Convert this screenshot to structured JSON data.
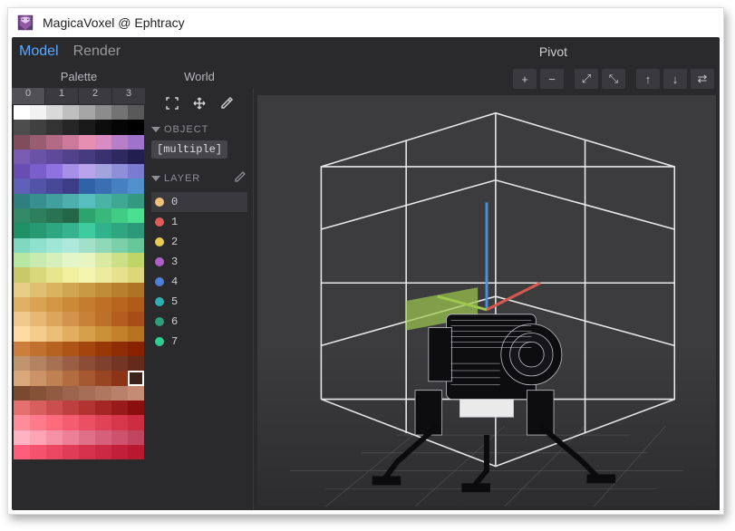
{
  "window": {
    "title": "MagicaVoxel @ Ephtracy"
  },
  "modes": {
    "model": "Model",
    "render": "Render",
    "active": "model",
    "pivot_label": "Pivot"
  },
  "palette": {
    "heading": "Palette",
    "tabs": [
      "0",
      "1",
      "2",
      "3"
    ],
    "active_tab": 0,
    "selected_index": 151,
    "colors": [
      "#ffffff",
      "#f2f2f2",
      "#d9d9d9",
      "#bfbfbf",
      "#a6a6a6",
      "#8c8c8c",
      "#737373",
      "#595959",
      "#4d4d4d",
      "#404040",
      "#333333",
      "#262626",
      "#1a1a1a",
      "#0d0d0d",
      "#050505",
      "#000000",
      "#804d5c",
      "#995c70",
      "#b36b85",
      "#cc7a99",
      "#e68fb0",
      "#d98cc2",
      "#b87fc9",
      "#9f73cc",
      "#7a5cb3",
      "#6a52a6",
      "#5e4a99",
      "#52428c",
      "#463a80",
      "#3a3270",
      "#2e2960",
      "#221f50",
      "#6a4db3",
      "#7a5ecc",
      "#8f72e0",
      "#a68fe6",
      "#b8a3eb",
      "#a3a3e0",
      "#8f8fd9",
      "#7a7ad0",
      "#5f5fb8",
      "#5353a8",
      "#484898",
      "#3d3d87",
      "#2f62a6",
      "#3a70b3",
      "#4580c0",
      "#5090cd",
      "#2e8080",
      "#388f8f",
      "#429f9f",
      "#4daeae",
      "#57bdbd",
      "#4ab3a3",
      "#3ea893",
      "#339980",
      "#338a66",
      "#2e805c",
      "#297352",
      "#246648",
      "#2fa36e",
      "#38b87a",
      "#40cc85",
      "#4adf91",
      "#1f8f66",
      "#269973",
      "#2ea680",
      "#36b38c",
      "#3ecc9e",
      "#30b38c",
      "#2ea680",
      "#2c997a",
      "#80d8c0",
      "#8fe0cc",
      "#9fe6d7",
      "#aee8db",
      "#a3e0c9",
      "#8fd9b8",
      "#7ad0a8",
      "#66c799",
      "#b8e6a3",
      "#c7ebb0",
      "#d6f0bd",
      "#e4f5ca",
      "#e6f5c2",
      "#d9eba3",
      "#cce085",
      "#bfd666",
      "#c9c96a",
      "#d9d97a",
      "#e6e68c",
      "#f0f09e",
      "#f5f5b0",
      "#edeb9e",
      "#e5e18c",
      "#ddd67a",
      "#e6cc85",
      "#e0bf73",
      "#d9b360",
      "#d1a652",
      "#c99945",
      "#c08c38",
      "#b8802e",
      "#b07326",
      "#e0b066",
      "#d9a352",
      "#d29645",
      "#cc8938",
      "#c57c2e",
      "#bf7026",
      "#b8661f",
      "#b05c18",
      "#f0c98c",
      "#e6b873",
      "#dba65c",
      "#d1944a",
      "#c78238",
      "#bd702a",
      "#b35e1f",
      "#a84d16",
      "#ffdba3",
      "#f5cc8c",
      "#ebbd75",
      "#e0ae5e",
      "#d69f4a",
      "#cc9038",
      "#c2812a",
      "#b87320",
      "#cc7f3d",
      "#c2702e",
      "#b86221",
      "#ae5416",
      "#a3450d",
      "#993807",
      "#902c03",
      "#872100",
      "#bf946e",
      "#b38260",
      "#a67052",
      "#995e45",
      "#8c4c38",
      "#80402e",
      "#733524",
      "#662a1a",
      "#d9a87a",
      "#cc9466",
      "#bf8052",
      "#b36c40",
      "#a65830",
      "#994524",
      "#8c3318",
      "#3b2319",
      "#7a4a2e",
      "#855238",
      "#915b42",
      "#9c644c",
      "#a66d56",
      "#b07760",
      "#ba816a",
      "#c58b74",
      "#e66f6f",
      "#d95e5e",
      "#cc4f4f",
      "#bf4040",
      "#b33333",
      "#a62626",
      "#991a1a",
      "#8c0f0f",
      "#ff8c99",
      "#ff7a8a",
      "#ff6b7d",
      "#f55c70",
      "#eb4f63",
      "#e04256",
      "#d6384a",
      "#cc2e40",
      "#ffb3c2",
      "#ffa3b5",
      "#f591a5",
      "#eb8096",
      "#e07088",
      "#d6607a",
      "#cc526d",
      "#c24560",
      "#ff5e7a",
      "#f5526e",
      "#eb4763",
      "#e03c58",
      "#d6324e",
      "#cc2944",
      "#c2203a",
      "#b81830"
    ]
  },
  "world": {
    "heading": "World",
    "object_label": "OBJECT",
    "object_value": "[multiple]",
    "layer_label": "LAYER",
    "layers": [
      {
        "num": "0",
        "color": "#f2c27a",
        "active": true
      },
      {
        "num": "1",
        "color": "#e05c5c",
        "active": false
      },
      {
        "num": "2",
        "color": "#e6cc52",
        "active": false
      },
      {
        "num": "3",
        "color": "#b060c9",
        "active": false
      },
      {
        "num": "4",
        "color": "#4f7fd6",
        "active": false
      },
      {
        "num": "5",
        "color": "#2fb0b0",
        "active": false
      },
      {
        "num": "6",
        "color": "#2f9e7a",
        "active": false
      },
      {
        "num": "7",
        "color": "#2ecc91",
        "active": false
      }
    ]
  },
  "viewport": {
    "toolbar": {
      "add": "+",
      "remove": "−",
      "expand": "⤢",
      "shrink": "⤡",
      "up": "↑",
      "down": "↓",
      "swap": "⇄"
    }
  }
}
